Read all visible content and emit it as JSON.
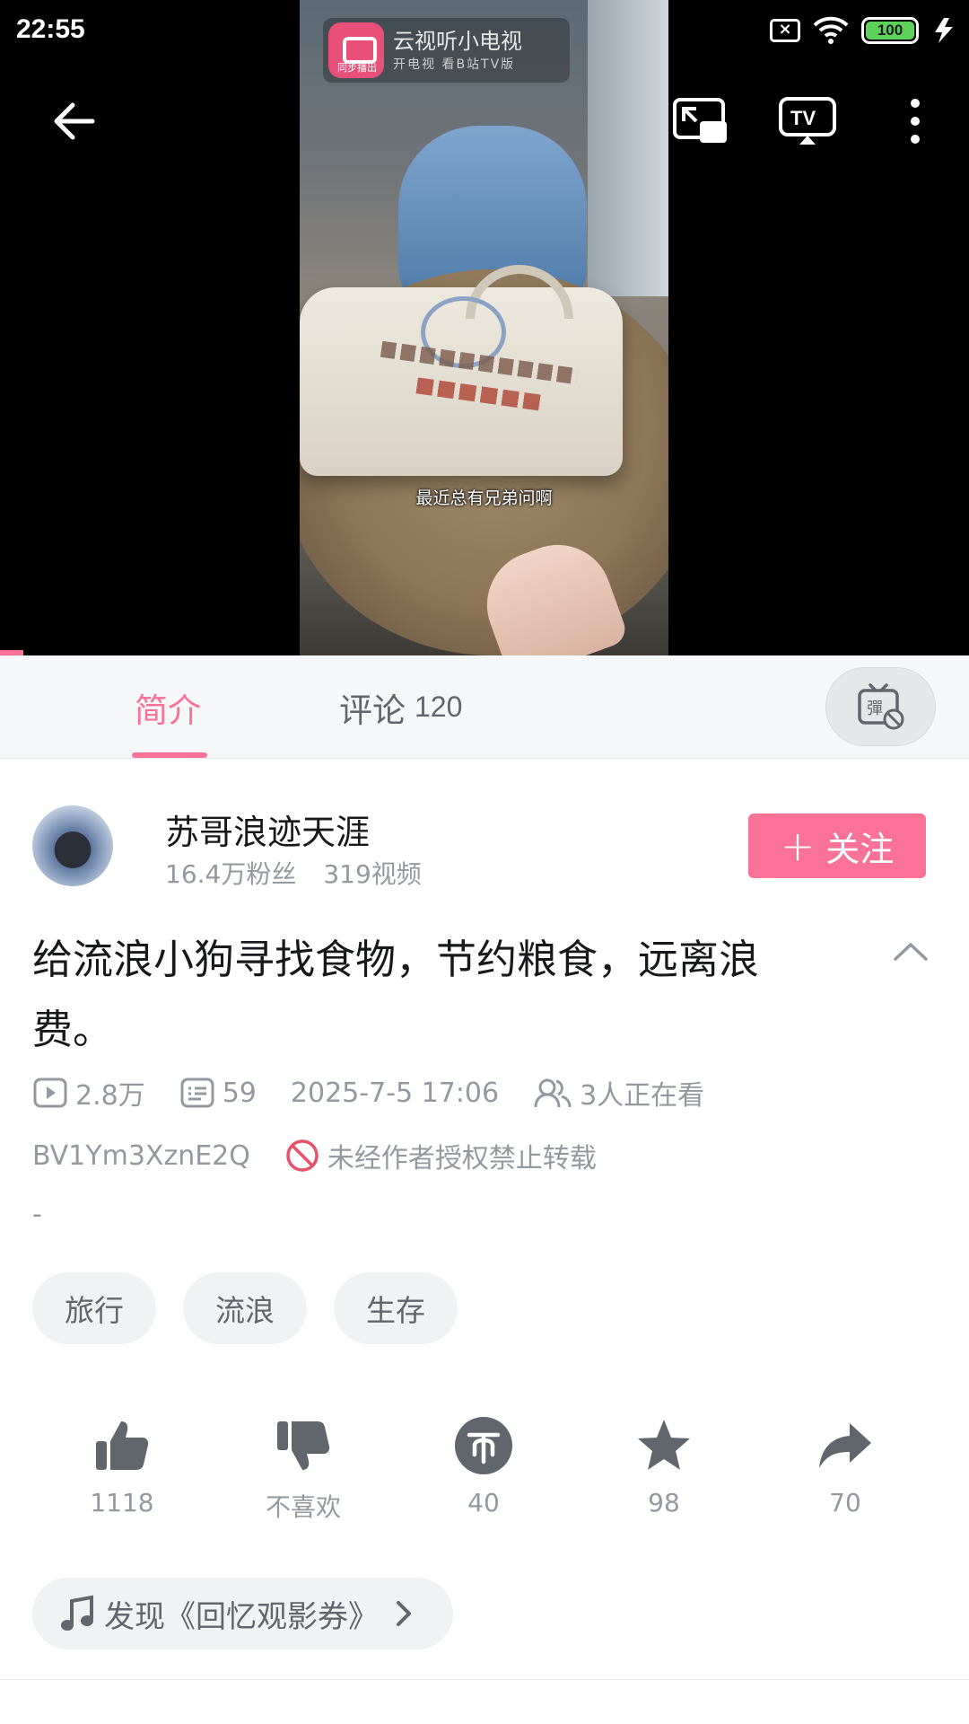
{
  "status_bar": {
    "time": "22:55",
    "battery_level": "100"
  },
  "video": {
    "subtitle": "最近总有兄弟问啊",
    "watermark_title": "云视听小电视",
    "watermark_sub": "开电视 看B站TV版",
    "watermark_badge": "同步播出"
  },
  "tabs": {
    "intro": "简介",
    "comments": "评论",
    "comments_count": "120"
  },
  "author": {
    "name": "苏哥浪迹天涯",
    "fans": "16.4万粉丝",
    "videos": "319视频",
    "follow_label": "关注"
  },
  "title": "给流浪小狗寻找食物，节约粮食，远离浪费。",
  "meta": {
    "views": "2.8万",
    "danmaku": "59",
    "date": "2025-7-5 17:06",
    "watching": "3人正在看",
    "bvid": "BV1Ym3XznE2Q",
    "copyright": "未经作者授权禁止转载",
    "description": "-"
  },
  "tags": [
    "旅行",
    "流浪",
    "生存"
  ],
  "actions": {
    "like": "1118",
    "dislike": "不喜欢",
    "coin": "40",
    "favorite": "98",
    "share": "70"
  },
  "discover": {
    "label": "发现《回忆观影券》"
  },
  "colors": {
    "accent": "#fb7299",
    "muted": "#9499a0",
    "icon": "#61666d"
  }
}
